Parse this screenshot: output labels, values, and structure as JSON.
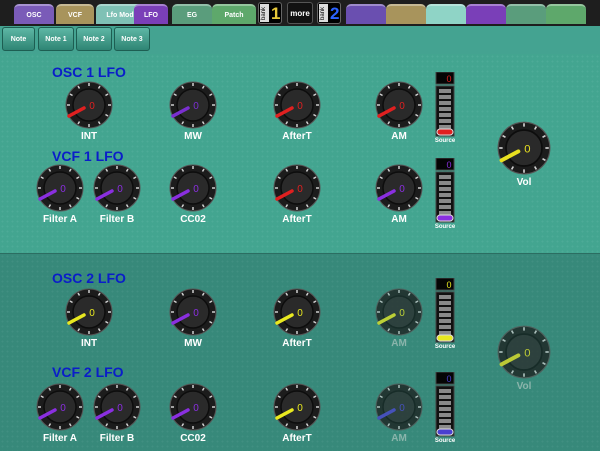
{
  "tabs": [
    {
      "label": "OSC",
      "color": "#7a5bb8"
    },
    {
      "label": "VCF",
      "color": "#a8945c"
    },
    {
      "label": "Lfo Mod",
      "color": "#7fc1b5"
    },
    {
      "label": "LFO",
      "color": "#7a3fb8"
    },
    {
      "label": "EG",
      "color": "#5a9d7c"
    },
    {
      "label": "Patch",
      "color": "#5ea86b"
    },
    {
      "label": "",
      "color": "#6a4fb0"
    },
    {
      "label": "",
      "color": "#a8945c"
    },
    {
      "label": "",
      "color": "#8fd4c6"
    },
    {
      "label": "",
      "color": "#7a3fb8"
    },
    {
      "label": "",
      "color": "#5a9d7c"
    },
    {
      "label": "",
      "color": "#5ea86b"
    }
  ],
  "bank1": {
    "label": "bank",
    "value": "1",
    "color": "#e8c93a"
  },
  "more_label": "more",
  "bank2": {
    "label": "bank",
    "value": "2",
    "color": "#2c63ff"
  },
  "note_buttons": [
    "Note",
    "Note 1",
    "Note 2",
    "Note 3"
  ],
  "sections": [
    {
      "title": "OSC 1 LFO"
    },
    {
      "title": "VCF 1 LFO"
    },
    {
      "title": "OSC 2 LFO"
    },
    {
      "title": "VCF 2 LFO"
    }
  ],
  "knobs": [
    {
      "label": "INT",
      "value": "0",
      "color": "#e02020",
      "dim": false
    },
    {
      "label": "MW",
      "value": "0",
      "color": "#7a2fd0",
      "dim": false
    },
    {
      "label": "AfterT",
      "value": "0",
      "color": "#e02020",
      "dim": false
    },
    {
      "label": "AM",
      "value": "0",
      "color": "#e02020",
      "dim": false
    },
    {
      "label": "Filter A",
      "value": "0",
      "color": "#8a2fe0",
      "dim": false
    },
    {
      "label": "Filter B",
      "value": "0",
      "color": "#8a2fe0",
      "dim": false
    },
    {
      "label": "CC02",
      "value": "0",
      "color": "#8a2fe0",
      "dim": false
    },
    {
      "label": "AfterT",
      "value": "0",
      "color": "#e02020",
      "dim": false
    },
    {
      "label": "AM",
      "value": "0",
      "color": "#8a2fe0",
      "dim": false
    },
    {
      "label": "Vol",
      "value": "0",
      "color": "#e8e020",
      "dim": false
    },
    {
      "label": "INT",
      "value": "0",
      "color": "#e8e820",
      "dim": false
    },
    {
      "label": "MW",
      "value": "0",
      "color": "#8a2fe0",
      "dim": false
    },
    {
      "label": "AfterT",
      "value": "0",
      "color": "#e8e820",
      "dim": false
    },
    {
      "label": "AM",
      "value": "0",
      "color": "#e8e820",
      "dim": true
    },
    {
      "label": "Vol",
      "value": "0",
      "color": "#e8e020",
      "dim": true
    },
    {
      "label": "Filter A",
      "value": "0",
      "color": "#8a2fe0",
      "dim": false
    },
    {
      "label": "Filter B",
      "value": "0",
      "color": "#8a2fe0",
      "dim": false
    },
    {
      "label": "CC02",
      "value": "0",
      "color": "#8a2fe0",
      "dim": false
    },
    {
      "label": "AfterT",
      "value": "0",
      "color": "#e8e820",
      "dim": false
    },
    {
      "label": "AM",
      "value": "0",
      "color": "#4a3fd0",
      "dim": true
    }
  ],
  "sliders": [
    {
      "value": "0",
      "label": "Source",
      "color": "#e02020"
    },
    {
      "value": "0",
      "label": "Source",
      "color": "#8a2fe0"
    },
    {
      "value": "0",
      "label": "Source",
      "color": "#e8e820"
    },
    {
      "value": "0",
      "label": "Source",
      "color": "#4a3fd0"
    }
  ],
  "knob_pointer_icon": "knob-pointer-icon"
}
